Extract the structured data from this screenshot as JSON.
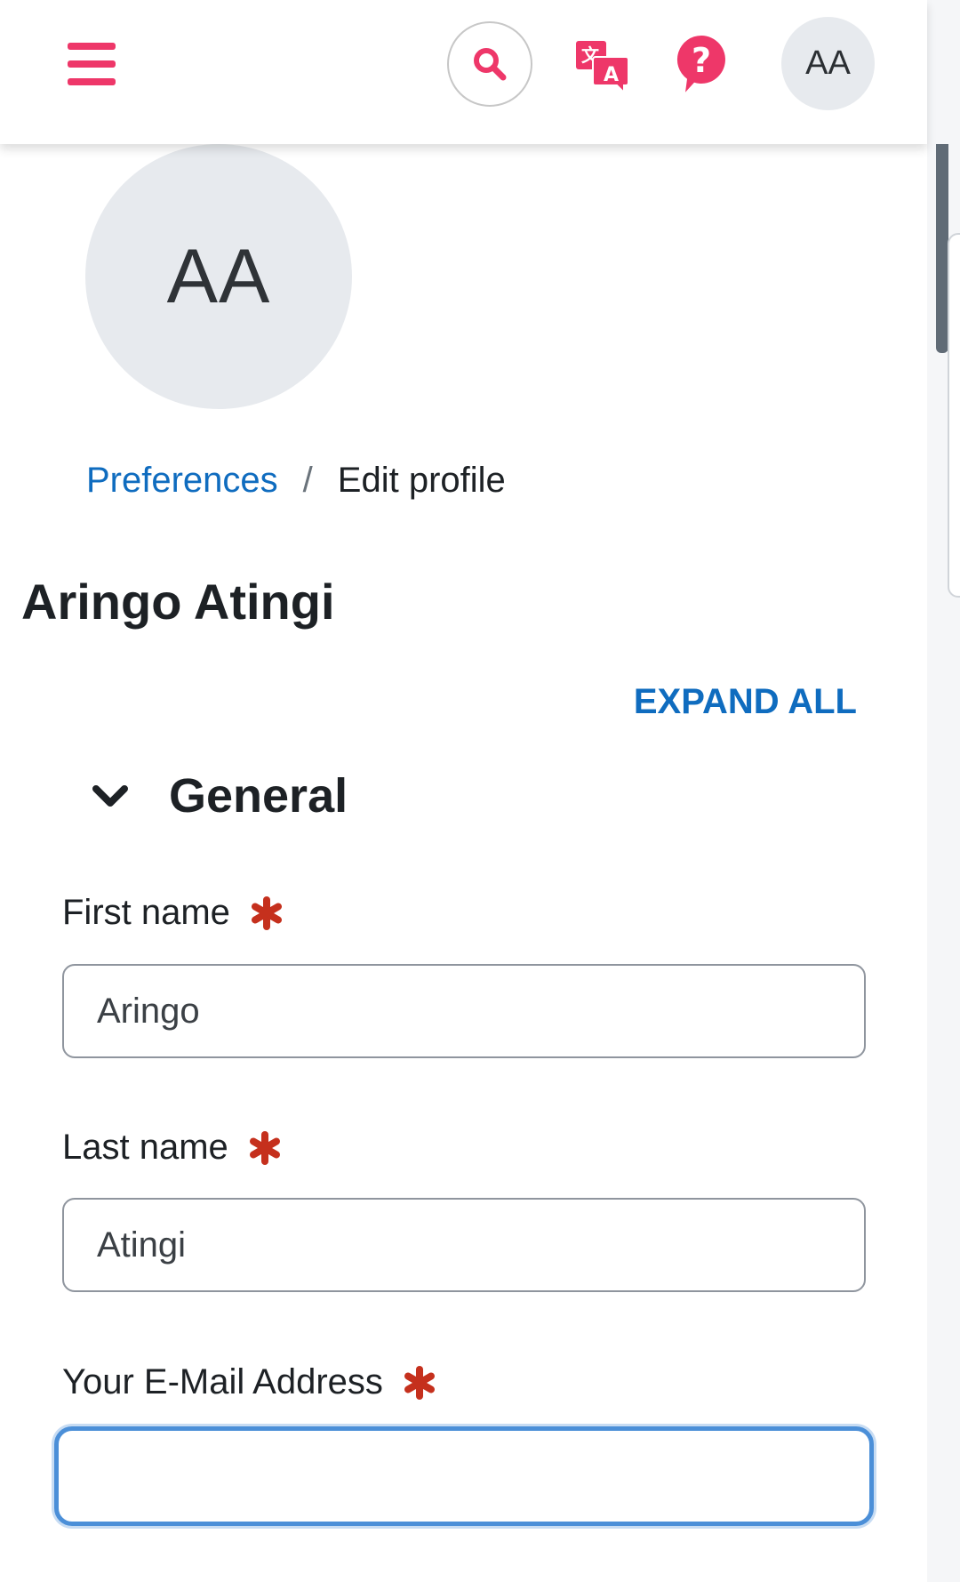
{
  "header": {
    "menu_icon": "hamburger-icon",
    "search_icon": "search-icon",
    "language_icon": "translate-icon",
    "help_icon": "help-icon",
    "user_initials": "AA",
    "accent_color": "#ee3769"
  },
  "profile": {
    "avatar_initials": "AA",
    "full_name": "Aringo Atingi"
  },
  "breadcrumb": {
    "parent": "Preferences",
    "separator": "/",
    "current": "Edit profile"
  },
  "form": {
    "expand_all": "EXPAND ALL",
    "section_title": "General",
    "fields": [
      {
        "label": "First name",
        "value": "Aringo",
        "required": true
      },
      {
        "label": "Last name",
        "value": "Atingi",
        "required": true
      },
      {
        "label": "Your E-Mail Address",
        "value": "",
        "required": true
      }
    ],
    "required_color": "#c5301d",
    "link_color": "#0f6cbf"
  }
}
